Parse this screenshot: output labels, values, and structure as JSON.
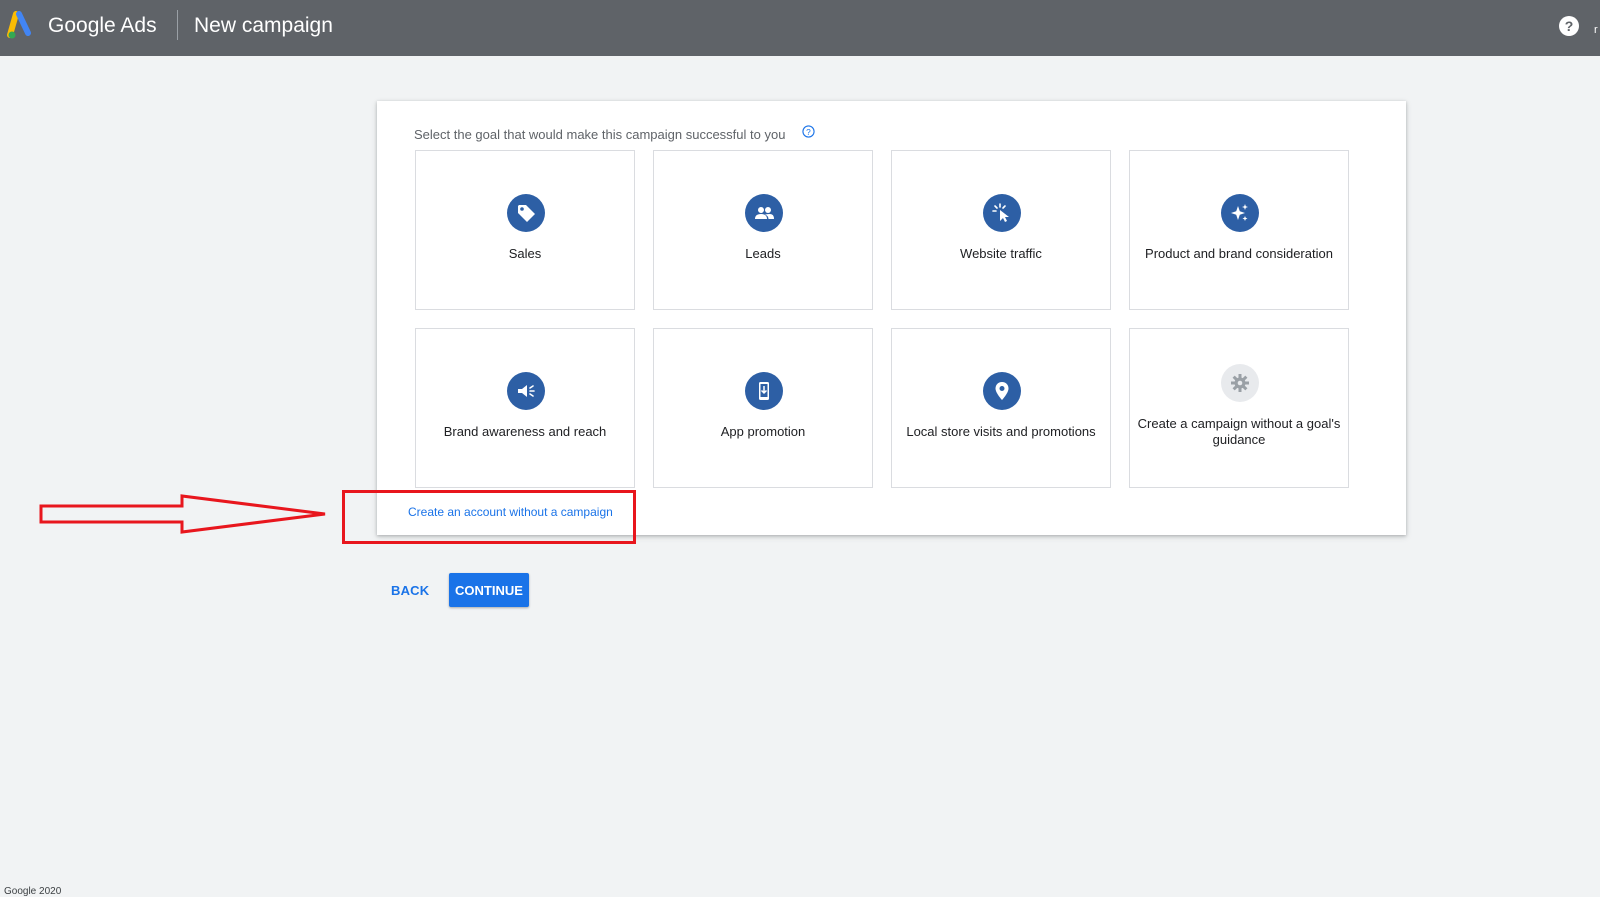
{
  "header": {
    "brand": "Google Ads",
    "page_title": "New campaign",
    "edge_text": "r"
  },
  "main": {
    "goal_prompt": "Select the goal that would make this campaign successful to you",
    "goals": [
      {
        "label": "Sales",
        "icon": "tag-icon"
      },
      {
        "label": "Leads",
        "icon": "people-icon"
      },
      {
        "label": "Website traffic",
        "icon": "cursor-click-icon"
      },
      {
        "label": "Product and brand consideration",
        "icon": "sparkle-icon"
      },
      {
        "label": "Brand awareness and reach",
        "icon": "megaphone-icon"
      },
      {
        "label": "App promotion",
        "icon": "phone-download-icon"
      },
      {
        "label": "Local store visits and promotions",
        "icon": "location-pin-icon"
      },
      {
        "label": "Create a campaign without a goal's guidance",
        "icon": "gear-icon"
      }
    ],
    "create_account_link": "Create an account without a campaign"
  },
  "actions": {
    "back_label": "BACK",
    "continue_label": "CONTINUE"
  },
  "annotation": {
    "color": "#e8161d"
  },
  "colors": {
    "topbar": "#5f6368",
    "accent": "#1a73e8",
    "icon_circle": "#2d5fa5"
  },
  "footer": {
    "text": "Google 2020"
  }
}
